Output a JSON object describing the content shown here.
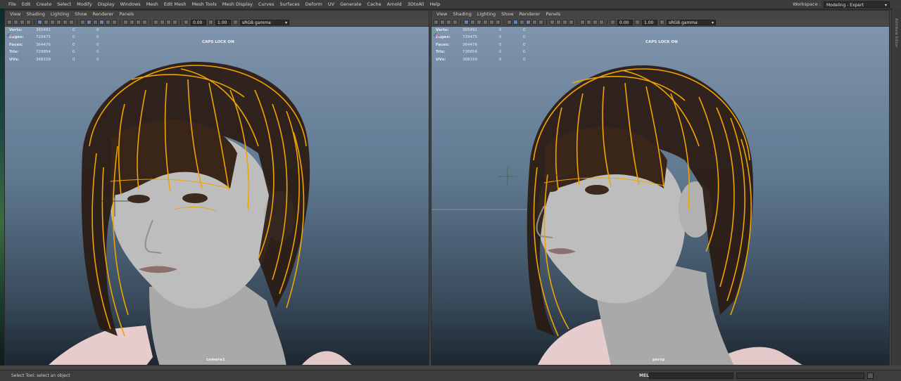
{
  "menubar": {
    "items": [
      "File",
      "Edit",
      "Create",
      "Select",
      "Modify",
      "Display",
      "Windows",
      "Mesh",
      "Edit Mesh",
      "Mesh Tools",
      "Mesh Display",
      "Curves",
      "Surfaces",
      "Deform",
      "UV",
      "Generate",
      "Cache",
      "Arnold",
      "3DtoAll",
      "Help"
    ],
    "workspace_label": "Workspace :",
    "workspace_value": "Modeling - Expert"
  },
  "attribute_editor_tab": "Attribute Editor",
  "panel_menu": [
    "View",
    "Shading",
    "Lighting",
    "Show",
    "Renderer",
    "Panels"
  ],
  "toolbar": {
    "exposure": "0.00",
    "gamma": "1.00",
    "colorspace": "sRGB gamma"
  },
  "hud": {
    "rows": [
      {
        "label": "Verts:",
        "v1": "365491",
        "v2": "0",
        "v3": "0"
      },
      {
        "label": "Edges:",
        "v1": "729475",
        "v2": "0",
        "v3": "0"
      },
      {
        "label": "Faces:",
        "v1": "364476",
        "v2": "0",
        "v3": "0"
      },
      {
        "label": "Tris:",
        "v1": "728854",
        "v2": "0",
        "v3": "0"
      },
      {
        "label": "UVs:",
        "v1": "368159",
        "v2": "0",
        "v3": "0"
      }
    ]
  },
  "caps_lock": "CAPS LOCK ON",
  "viewports": [
    {
      "camera": "camera1"
    },
    {
      "camera": "persp"
    }
  ],
  "colors": {
    "hair_guides": "#f0a400",
    "hair_strands": "#2a1a12",
    "skin": "#b9b9b9",
    "background_top": "#7f94ad",
    "background_bottom": "#1d2731"
  },
  "status": {
    "help_text": "Select Tool: select an object",
    "mel_label": "MEL"
  }
}
